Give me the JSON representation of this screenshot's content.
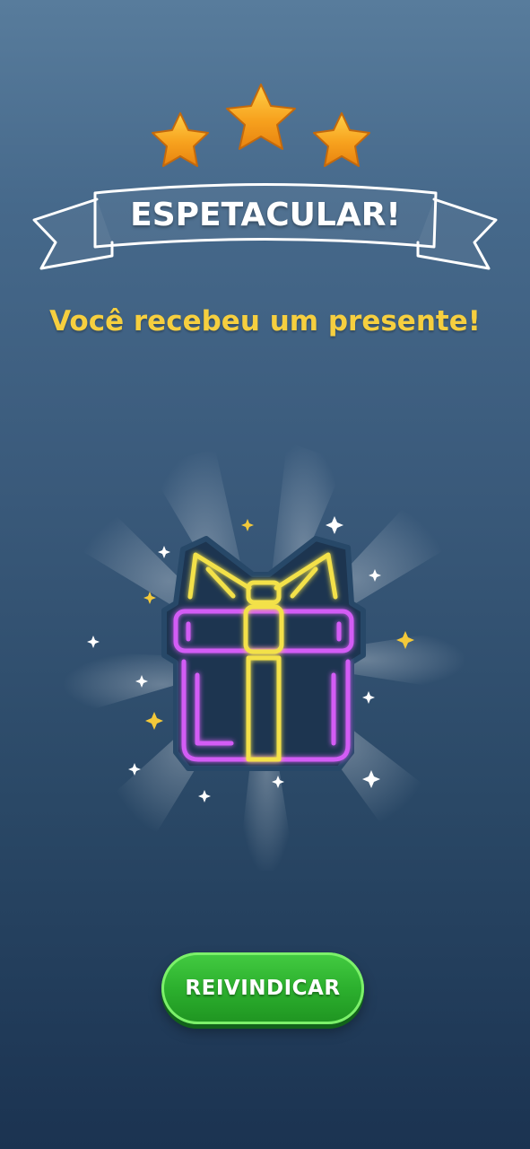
{
  "rating": {
    "stars_earned": 3,
    "stars_total": 3,
    "title": "ESPETACULAR!"
  },
  "reward": {
    "message": "Você recebeu um presente!",
    "icon": "gift-icon"
  },
  "actions": {
    "claim_label": "REIVINDICAR"
  },
  "colors": {
    "star": "#f5a623",
    "message": "#f6cf3f",
    "button": "#2cb02e",
    "gift_box_neon": "#d35cf5",
    "gift_ribbon_neon": "#f3e14a"
  }
}
